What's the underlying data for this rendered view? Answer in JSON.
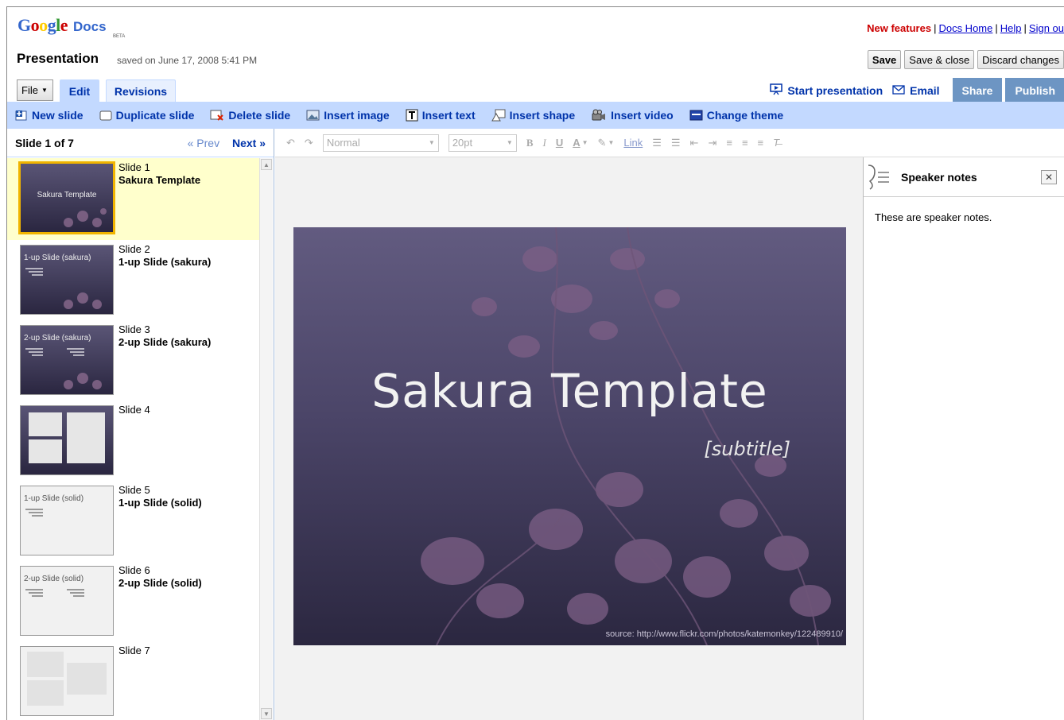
{
  "header": {
    "logo_google": "Google",
    "logo_docs": "Docs",
    "logo_beta": "BETA",
    "new_features": "New features",
    "links": [
      "Docs Home",
      "Help",
      "Sign ou"
    ]
  },
  "document": {
    "title": "Presentation",
    "saved": "saved on June 17, 2008 5:41 PM"
  },
  "actions": {
    "save": "Save",
    "save_close": "Save & close",
    "discard": "Discard changes"
  },
  "tabs": {
    "file": "File",
    "edit": "Edit",
    "revisions": "Revisions"
  },
  "right_actions": {
    "start": "Start presentation",
    "email": "Email",
    "share": "Share",
    "publish": "Publish"
  },
  "toolbar": {
    "new_slide": "New slide",
    "duplicate_slide": "Duplicate slide",
    "delete_slide": "Delete slide",
    "insert_image": "Insert image",
    "insert_text": "Insert text",
    "insert_shape": "Insert shape",
    "insert_video": "Insert video",
    "change_theme": "Change theme"
  },
  "slide_panel": {
    "count": "Slide 1 of 7",
    "prev": "« Prev",
    "next": "Next »",
    "slides": [
      {
        "num": "Slide 1",
        "title": "Sakura Template",
        "thumb_text": "Sakura Template"
      },
      {
        "num": "Slide 2",
        "title": "1-up Slide (sakura)",
        "thumb_text": "1-up Slide (sakura)"
      },
      {
        "num": "Slide 3",
        "title": "2-up Slide (sakura)",
        "thumb_text": "2-up Slide (sakura)"
      },
      {
        "num": "Slide 4",
        "title": "",
        "thumb_text": ""
      },
      {
        "num": "Slide 5",
        "title": "1-up Slide (solid)",
        "thumb_text": "1-up Slide (solid)"
      },
      {
        "num": "Slide 6",
        "title": "2-up Slide (solid)",
        "thumb_text": "2-up Slide (solid)"
      },
      {
        "num": "Slide 7",
        "title": "",
        "thumb_text": ""
      }
    ]
  },
  "format": {
    "style": "Normal",
    "size": "20pt",
    "bold": "B",
    "italic": "I",
    "underline": "U",
    "text_color": "A",
    "link": "Link"
  },
  "slide": {
    "title": "Sakura Template",
    "subtitle": "[subtitle]",
    "source": "source: http://www.flickr.com/photos/katemonkey/122489910/"
  },
  "notes": {
    "title": "Speaker notes",
    "body": "These are speaker notes."
  },
  "colors": {
    "toolbar_bg": "#c3d9ff",
    "link_blue": "#0033aa",
    "new_features_red": "#cc0000",
    "share_btn": "#6d95c3",
    "selected_slide_bg": "#ffffcc",
    "slide_bg": "#4b4568"
  }
}
